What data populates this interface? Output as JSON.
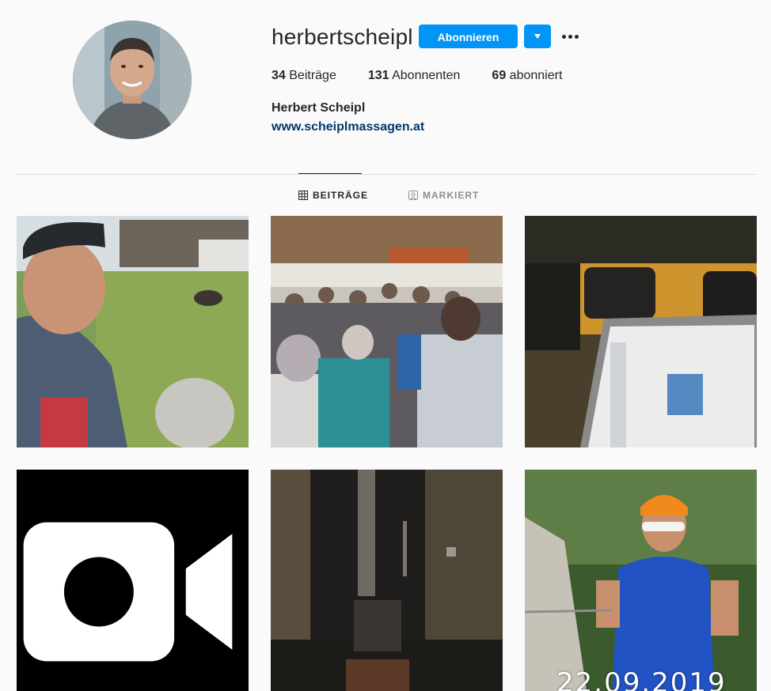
{
  "profile": {
    "username": "herbertscheipl",
    "follow_label": "Abonnieren",
    "full_name": "Herbert Scheipl",
    "website": "www.scheiplmassagen.at",
    "stats": [
      {
        "count": "34",
        "label": "Beiträge"
      },
      {
        "count": "131",
        "label": "Abonnenten"
      },
      {
        "count": "69",
        "label": "abonniert"
      }
    ]
  },
  "tabs": [
    {
      "label": "BEITRÄGE",
      "icon": "grid-icon",
      "active": true
    },
    {
      "label": "MARKIERT",
      "icon": "tagged-person-icon",
      "active": false
    }
  ],
  "posts": [
    {
      "description_icon": "photo",
      "kind": "image"
    },
    {
      "description_icon": "photo",
      "kind": "image"
    },
    {
      "description_icon": "photo",
      "kind": "image"
    },
    {
      "description_icon": "video-icon",
      "kind": "video"
    },
    {
      "description_icon": "photo",
      "kind": "image"
    },
    {
      "description_icon": "photo",
      "kind": "image",
      "overlay_text": "22.09.2019"
    }
  ],
  "colors": {
    "accent": "#0095f6",
    "link": "#00376b",
    "text": "#262626",
    "muted": "#8e8e8e",
    "background": "#fafafa"
  }
}
